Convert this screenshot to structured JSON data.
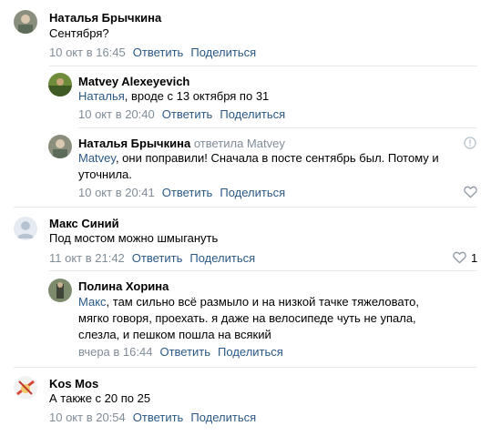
{
  "comments": [
    {
      "author": "Наталья Брычкина",
      "text": "Сентября?",
      "date": "10 окт в 16:45",
      "reply_label": "Ответить",
      "share_label": "Поделиться"
    },
    {
      "author": "Matvey Alexeyevich",
      "mention": "Наталья",
      "text": ", вроде с 13 октября по 31",
      "date": "10 окт в 20:40",
      "reply_label": "Ответить",
      "share_label": "Поделиться"
    },
    {
      "author": "Наталья Брычкина",
      "replied_to": "ответила Matvey",
      "mention": "Matvey",
      "text": ", они поправили! Сначала в посте сентябрь был. Потому и уточнила.",
      "date": "10 окт в 20:41",
      "reply_label": "Ответить",
      "share_label": "Поделиться"
    },
    {
      "author": "Макс Синий",
      "text": "Под мостом можно шмыгануть",
      "date": "11 окт в 21:42",
      "reply_label": "Ответить",
      "share_label": "Поделиться",
      "likes": "1"
    },
    {
      "author": "Полина Хорина",
      "mention": "Макс",
      "text": ", там сильно всё размыло и на низкой тачке тяжеловато, мягко говоря, проехать. я даже на велосипеде чуть не упала, слезла, и пешком пошла на всякий",
      "date": "вчера в 16:44",
      "reply_label": "Ответить",
      "share_label": "Поделиться"
    },
    {
      "author": "Kos Mos",
      "text": "А также с 20 по 25",
      "date": "10 окт в 20:54",
      "reply_label": "Ответить",
      "share_label": "Поделиться"
    }
  ],
  "colors": {
    "link": "#2a5885",
    "meta": "#818c99",
    "divider": "#e7e8ec"
  },
  "icons": [
    "report-icon",
    "heart-icon"
  ]
}
